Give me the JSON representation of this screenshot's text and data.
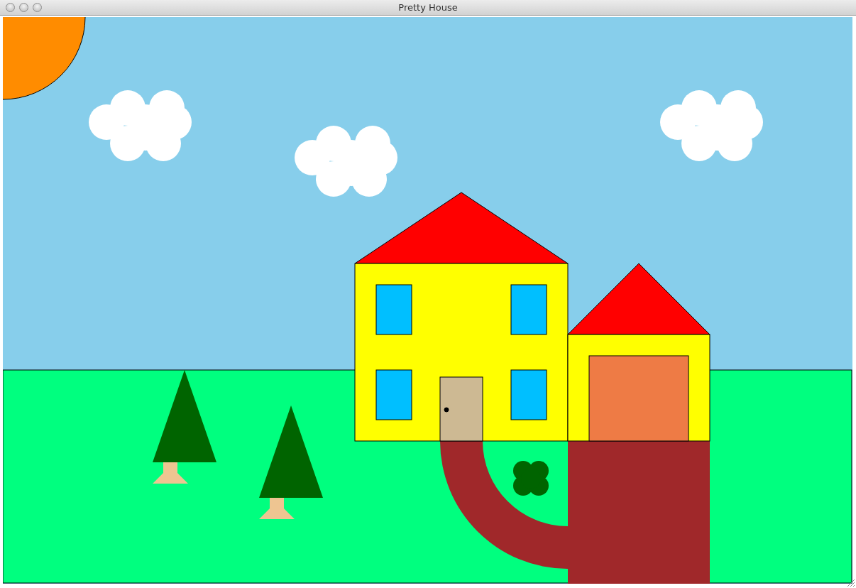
{
  "window": {
    "title": "Pretty House"
  }
}
